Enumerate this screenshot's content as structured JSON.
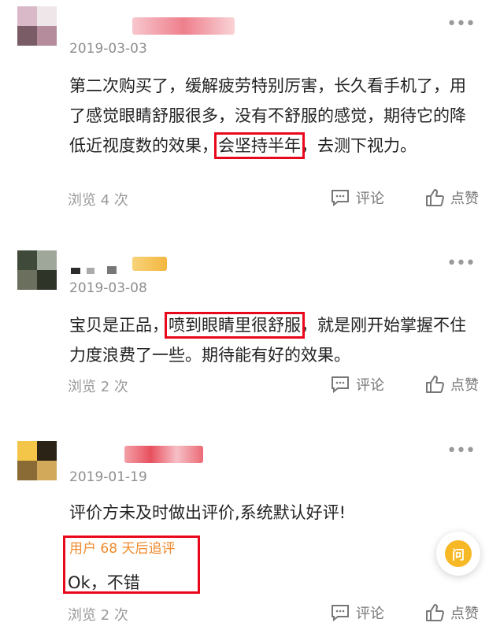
{
  "reviews": [
    {
      "date": "2019-03-03",
      "content_before": "第二次购买了，缓解疲劳特别厉害，长久看手机了，用了感觉眼睛舒服很多，没有不舒服的感觉，期待它的降低近视度数的效果，",
      "content_highlight": "会坚持半年",
      "content_after": "，去测下视力。",
      "views": "浏览 4 次",
      "comment_label": "评论",
      "like_label": "点赞"
    },
    {
      "date": "2019-03-08",
      "content_before": "宝贝是正品，",
      "content_highlight": "喷到眼睛里很舒服",
      "content_after": "，就是刚开始掌握不住力度浪费了一些。期待能有好的效果。",
      "views": "浏览 2 次",
      "comment_label": "评论",
      "like_label": "点赞"
    },
    {
      "date": "2019-01-19",
      "content": "评价方未及时做出评价,系统默认好评!",
      "followup_label": "用户 68 天后追评",
      "followup_text": "Ok，不错",
      "views": "浏览 2 次",
      "comment_label": "评论",
      "like_label": "点赞"
    }
  ],
  "more_glyph": "•••",
  "fab_label": "问",
  "icons": {
    "more": "more-dots-icon",
    "comment": "comment-bubble-icon",
    "like": "thumbs-up-icon",
    "fab": "question-icon"
  },
  "colors": {
    "highlight_box": "#e8081c",
    "followup_label": "#f08a2c",
    "fab": "#f7b825",
    "muted": "#999999"
  }
}
